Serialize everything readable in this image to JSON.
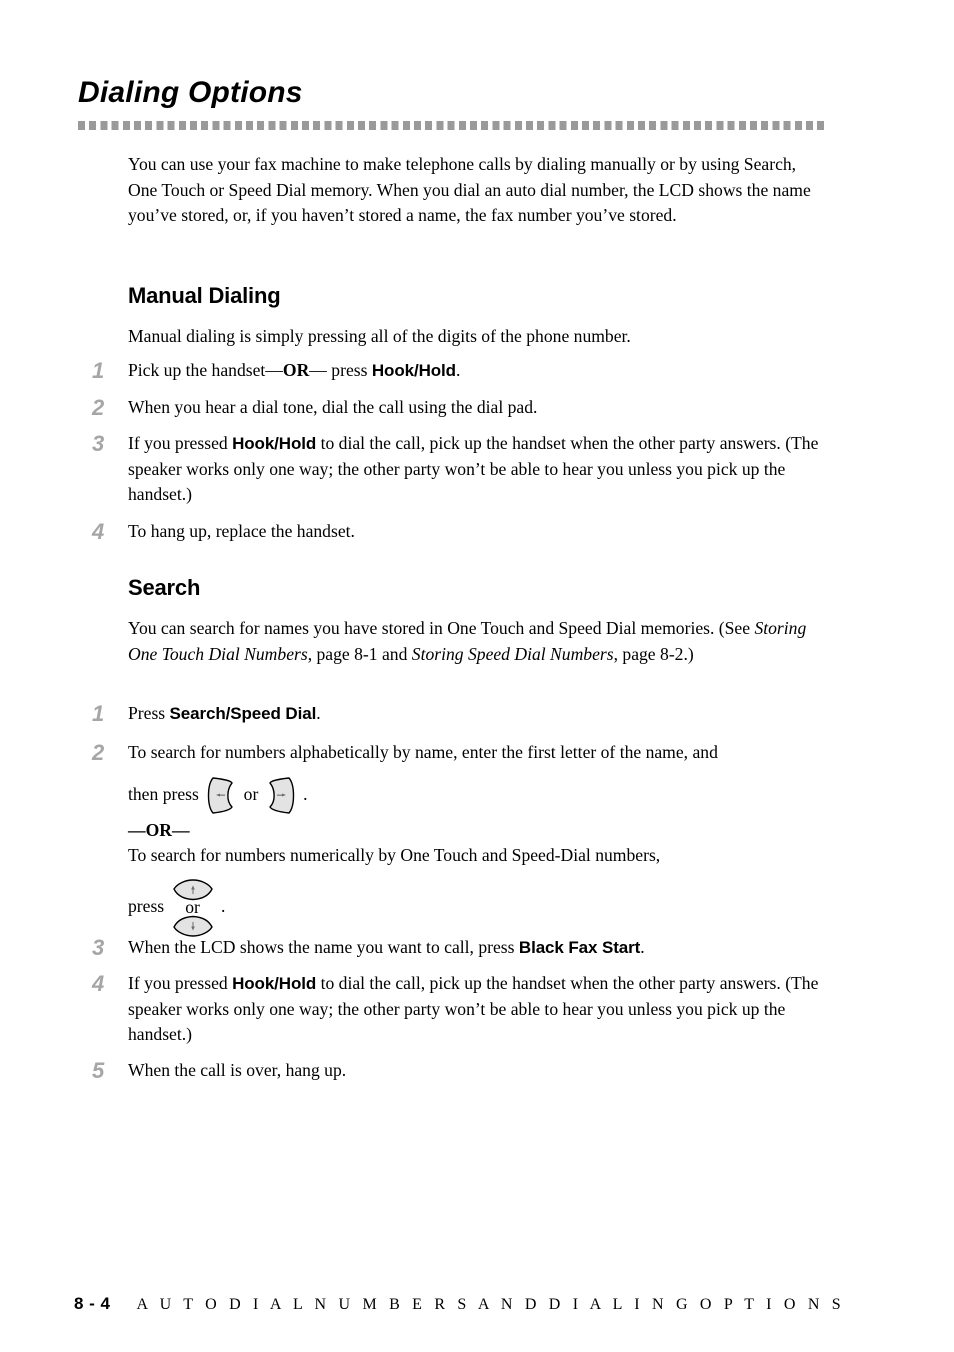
{
  "document": {
    "title": "Dialing Options",
    "intro": "You can use your fax machine to make telephone calls by dialing manually or by using Search, One Touch or Speed Dial memory. When you dial an auto dial number, the LCD shows the name you’ve stored, or, if you haven’t  stored a name, the fax number you’ve stored."
  },
  "manual_dialing": {
    "heading": "Manual Dialing",
    "lead": "Manual dialing is simply pressing all of the digits of the phone number.",
    "steps": [
      {
        "number": "1",
        "text_before": "Pick up the handset—",
        "bold_serif": "OR",
        "text_middle": "— press ",
        "key": "Hook/Hold",
        "text_after": "."
      },
      {
        "number": "2",
        "text": "When you hear a dial tone, dial the call using the dial pad."
      },
      {
        "number": "3",
        "text_before": "If you pressed ",
        "key": "Hook/Hold",
        "text_after": " to dial the call, pick up the handset when the other party answers. (The speaker works only one way; the other party won’t be able to hear you unless you pick up the handset.)"
      },
      {
        "number": "4",
        "text": "To hang up, replace the handset."
      }
    ]
  },
  "search": {
    "heading": "Search",
    "lead_before": "You can search for names you have stored in One Touch and Speed Dial memories. (See ",
    "lead_ref1": "Storing One Touch Dial Numbers",
    "lead_middle": ", page 8-1 and ",
    "lead_ref2": "Storing Speed Dial Numbers",
    "lead_after": ", page 8-2.)",
    "steps": [
      {
        "number": "1",
        "text_before": "Press ",
        "key": "Search/Speed Dial",
        "text_after": "."
      },
      {
        "number": "2",
        "text": "To search for numbers alphabetically by name, enter the first letter of the name, and",
        "press_label": "then press",
        "between_keys": "or",
        "period": ".",
        "or_divider": "—OR—",
        "alt_text": "To search for numbers numerically by One Touch and Speed-Dial numbers,",
        "press_label_2": "press",
        "updown_or": "or",
        "period_2": ".",
        "icons": {
          "left_key": "left-arrow-key-icon",
          "right_key": "right-arrow-key-icon",
          "up_key": "up-arrow-key-icon",
          "down_key": "down-arrow-key-icon"
        }
      },
      {
        "number": "3",
        "text_before": "When the LCD shows the name you want to call, press ",
        "key": "Black Fax Start",
        "text_after": "."
      },
      {
        "number": "4",
        "text_before": "If you pressed ",
        "key": "Hook/Hold",
        "text_after": " to dial the call, pick up the handset when the other party answers. (The speaker works only one way; the other party won’t be able to hear you unless you pick up the handset.)"
      },
      {
        "number": "5",
        "text": "When the call is over, hang up."
      }
    ]
  },
  "footer": {
    "page_number": "8 - 4",
    "running_title": "A U T O   D I A L   N U M B E R S   A N D   D I A L I N G   O P T I O N S"
  },
  "colors": {
    "step_number_gray": "#a6a6a6",
    "rule_gray": "#9a9a9a",
    "key_fill": "#e3e3e3",
    "text_black": "#000000"
  }
}
